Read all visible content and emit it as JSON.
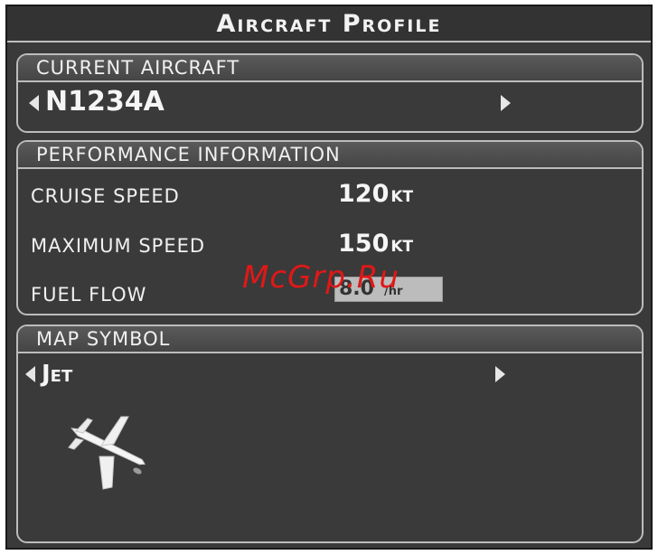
{
  "title": "Aircraft Profile",
  "current_aircraft": {
    "header": "CURRENT AIRCRAFT",
    "value": "N1234A"
  },
  "performance": {
    "header": "PERFORMANCE INFORMATION",
    "cruise_label": "CRUISE SPEED",
    "cruise_value": "120",
    "cruise_unit": "KT",
    "max_label": "MAXIMUM SPEED",
    "max_value": "150",
    "max_unit": "KT",
    "fuel_label": "FUEL FLOW",
    "fuel_value": "8.0",
    "fuel_unit": "/hr"
  },
  "map_symbol": {
    "header": "MAP SYMBOL",
    "value": "Jet",
    "icon": "jet-aircraft-icon"
  },
  "watermark": "McGrp.Ru",
  "colors": {
    "background": "#3a3a3a",
    "border": "#bcbcbc",
    "text": "#f0f0f0",
    "watermark": "#e01818"
  }
}
